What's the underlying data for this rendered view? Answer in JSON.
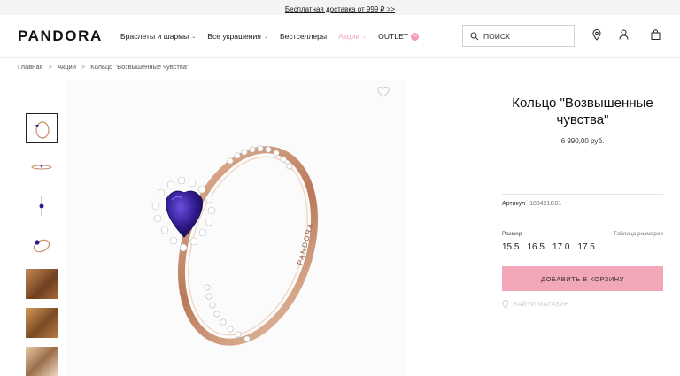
{
  "promo": {
    "text": "Бесплатная доставка от 999 ₽ >>"
  },
  "header": {
    "logo": "PANDORA",
    "nav": [
      {
        "label": "Браслеты и шармы"
      },
      {
        "label": "Все украшения"
      },
      {
        "label": "Бестселлеры"
      },
      {
        "label": "Акции"
      },
      {
        "label": "OUTLET"
      }
    ],
    "search_placeholder": "ПОИСК",
    "icons": [
      "search-icon",
      "location-icon",
      "user-icon",
      "bag-icon"
    ],
    "accent_color": "#f2a7b8"
  },
  "breadcrumb": [
    "Главная",
    "Акции",
    "Кольцо \"Возвышенные чувства\""
  ],
  "product": {
    "title": "Кольцо \"Возвышенные чувства\"",
    "price": "6 990,00 руб.",
    "article_label": "Артикул",
    "article_number": "188421C01",
    "size_label": "Размер",
    "size_chart_label": "Таблица размеров",
    "sizes": [
      "15.5",
      "16.5",
      "17.0",
      "17.5"
    ],
    "add_to_cart": "ДОБАВИТЬ В КОРЗИНУ",
    "find_store": "НАЙТИ МАГАЗИН",
    "gem_color": "#2f1a8c",
    "metal_color": "#c98c6e"
  }
}
